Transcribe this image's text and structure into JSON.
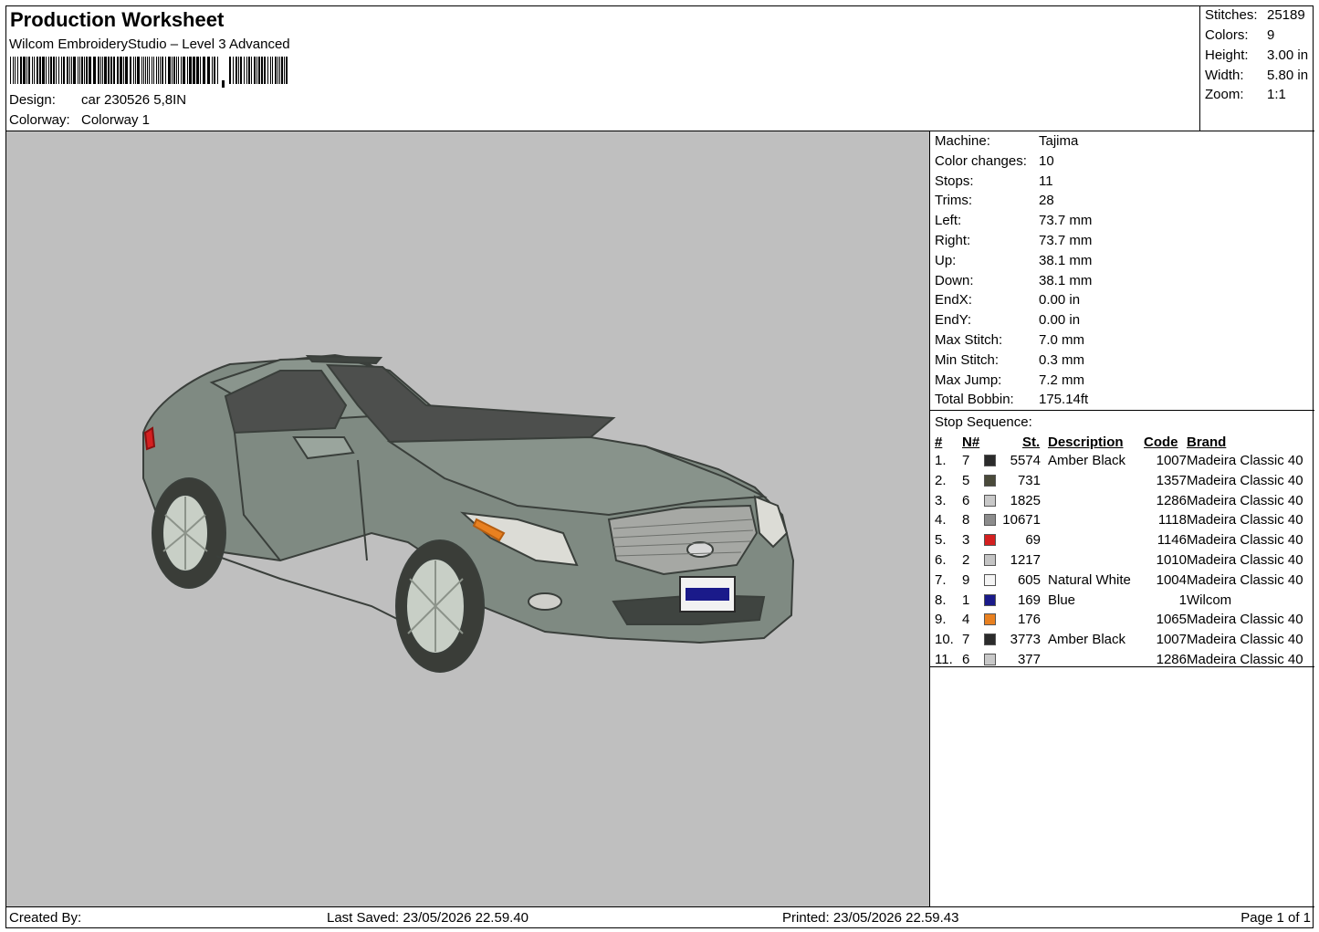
{
  "header": {
    "title": "Production Worksheet",
    "subtitle": "Wilcom EmbroideryStudio – Level 3 Advanced",
    "design_label": "Design:",
    "design_value": "car 230526 5,8IN",
    "colorway_label": "Colorway:",
    "colorway_value": "Colorway 1"
  },
  "summary": {
    "stitches_label": "Stitches:",
    "stitches": "25189",
    "colors_label": "Colors:",
    "colors": "9",
    "height_label": "Height:",
    "height": "3.00 in",
    "width_label": "Width:",
    "width": "5.80 in",
    "zoom_label": "Zoom:",
    "zoom": "1:1"
  },
  "machine_info": [
    {
      "label": "Machine:",
      "value": "Tajima"
    },
    {
      "label": "Color changes:",
      "value": "10"
    },
    {
      "label": "Stops:",
      "value": "11"
    },
    {
      "label": "Trims:",
      "value": "28"
    },
    {
      "label": "Left:",
      "value": "73.7 mm"
    },
    {
      "label": "Right:",
      "value": "73.7 mm"
    },
    {
      "label": "Up:",
      "value": "38.1 mm"
    },
    {
      "label": "Down:",
      "value": "38.1 mm"
    },
    {
      "label": "EndX:",
      "value": "0.00 in"
    },
    {
      "label": "EndY:",
      "value": "0.00 in"
    },
    {
      "label": "Max Stitch:",
      "value": "7.0 mm"
    },
    {
      "label": "Min Stitch:",
      "value": "0.3 mm"
    },
    {
      "label": "Max Jump:",
      "value": "7.2 mm"
    },
    {
      "label": "Total Bobbin:",
      "value": "175.14ft"
    }
  ],
  "stop_sequence": {
    "title": "Stop Sequence:",
    "headers": {
      "idx": "#",
      "n": "N#",
      "st": "St.",
      "desc": "Description",
      "code": "Code",
      "brand": "Brand"
    },
    "rows": [
      {
        "idx": "1.",
        "n": "7",
        "color": "#2b2b2b",
        "st": "5574",
        "desc": "Amber Black",
        "code": "1007",
        "brand": "Madeira Classic 40"
      },
      {
        "idx": "2.",
        "n": "5",
        "color": "#4a4a3a",
        "st": "731",
        "desc": "",
        "code": "1357",
        "brand": "Madeira Classic 40"
      },
      {
        "idx": "3.",
        "n": "6",
        "color": "#c8c8c8",
        "st": "1825",
        "desc": "",
        "code": "1286",
        "brand": "Madeira Classic 40"
      },
      {
        "idx": "4.",
        "n": "8",
        "color": "#8c8c8c",
        "st": "10671",
        "desc": "",
        "code": "1118",
        "brand": "Madeira Classic 40"
      },
      {
        "idx": "5.",
        "n": "3",
        "color": "#d42020",
        "st": "69",
        "desc": "",
        "code": "1146",
        "brand": "Madeira Classic 40"
      },
      {
        "idx": "6.",
        "n": "2",
        "color": "#c4c4c4",
        "st": "1217",
        "desc": "",
        "code": "1010",
        "brand": "Madeira Classic 40"
      },
      {
        "idx": "7.",
        "n": "9",
        "color": "#f4f4f4",
        "st": "605",
        "desc": "Natural White",
        "code": "1004",
        "brand": "Madeira Classic 40"
      },
      {
        "idx": "8.",
        "n": "1",
        "color": "#1a1a8a",
        "st": "169",
        "desc": "Blue",
        "code": "1",
        "brand": "Wilcom"
      },
      {
        "idx": "9.",
        "n": "4",
        "color": "#e88020",
        "st": "176",
        "desc": "",
        "code": "1065",
        "brand": "Madeira Classic 40"
      },
      {
        "idx": "10.",
        "n": "7",
        "color": "#2b2b2b",
        "st": "3773",
        "desc": "Amber Black",
        "code": "1007",
        "brand": "Madeira Classic 40"
      },
      {
        "idx": "11.",
        "n": "6",
        "color": "#c8c8c8",
        "st": "377",
        "desc": "",
        "code": "1286",
        "brand": "Madeira Classic 40"
      }
    ]
  },
  "footer": {
    "created_by": "Created By:",
    "last_saved": "Last Saved: 23/05/2026 22.59.40",
    "printed": "Printed: 23/05/2026 22.59.43",
    "page": "Page 1 of 1"
  },
  "canvas": {
    "background_color": "#bfbfbf",
    "car_body_color": "#7f8a82"
  }
}
